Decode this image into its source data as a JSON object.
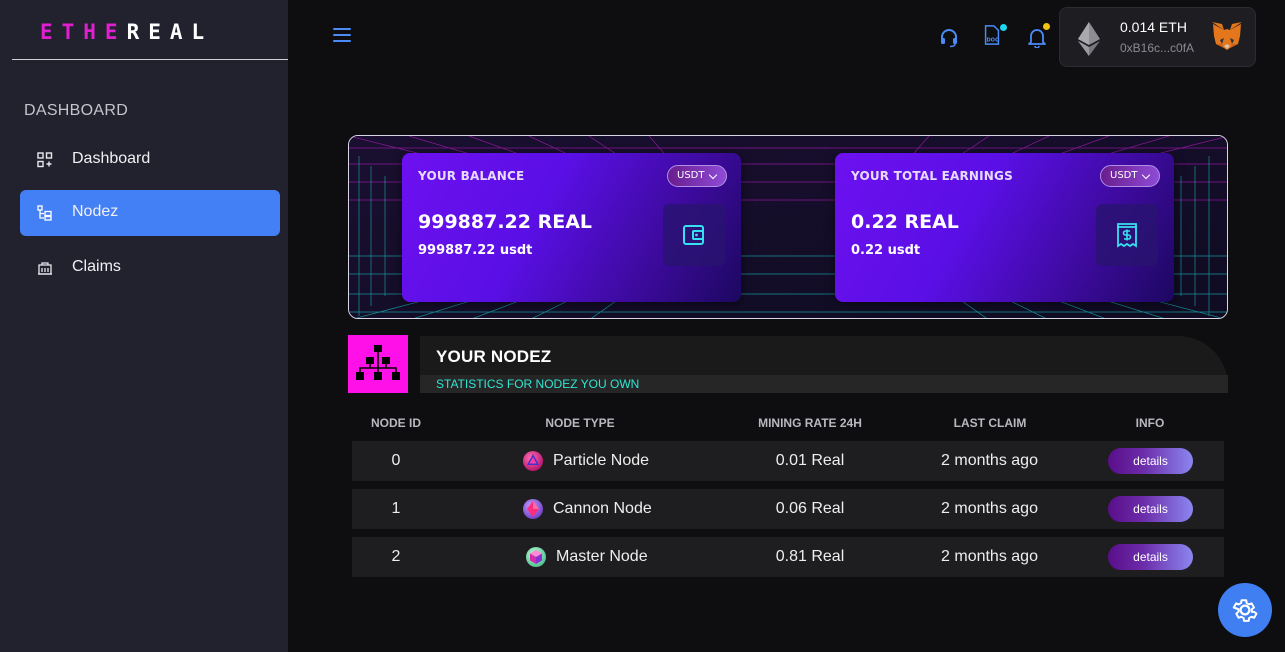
{
  "app": {
    "logo": {
      "part_a": "ETHE",
      "part_b": "REAL"
    }
  },
  "sidebar": {
    "section_label": "DASHBOARD",
    "items": [
      {
        "label": "Dashboard",
        "icon": "dashboard-icon",
        "active": false
      },
      {
        "label": "Nodez",
        "icon": "nodes-tree-icon",
        "active": true
      },
      {
        "label": "Claims",
        "icon": "claims-icon",
        "active": false
      }
    ]
  },
  "header": {
    "icons": [
      "menu-icon",
      "support-headset-icon",
      "docs-icon",
      "notification-bell-icon"
    ],
    "wallet": {
      "balance": "0.014 ETH",
      "address": "0xB16c...c0fA",
      "icon": "ethereum-icon",
      "provider_icon": "metamask-fox-icon"
    }
  },
  "banner": {
    "balance_card": {
      "title": "YOUR BALANCE",
      "currency": "USDT",
      "amount": "999887.22 REAL",
      "usdt": "999887.22 usdt",
      "icon": "wallet-icon"
    },
    "earnings_card": {
      "title": "YOUR TOTAL EARNINGS",
      "currency": "USDT",
      "amount": "0.22 REAL",
      "usdt": "0.22 usdt",
      "icon": "receipt-dollar-icon"
    }
  },
  "nodez": {
    "title": "YOUR NODEZ",
    "subtitle": "STATISTICS FOR NODEZ YOU OWN",
    "columns": [
      "NODE ID",
      "NODE TYPE",
      "MINING RATE 24H",
      "LAST CLAIM",
      "INFO"
    ],
    "rows": [
      {
        "id": "0",
        "type": "Particle Node",
        "icon": "particle-node-icon",
        "rate": "0.01 Real",
        "last_claim": "2 months ago",
        "action": "details"
      },
      {
        "id": "1",
        "type": "Cannon Node",
        "icon": "cannon-node-icon",
        "rate": "0.06 Real",
        "last_claim": "2 months ago",
        "action": "details"
      },
      {
        "id": "2",
        "type": "Master Node",
        "icon": "master-node-icon",
        "rate": "0.81 Real",
        "last_claim": "2 months ago",
        "action": "details"
      }
    ]
  },
  "colors": {
    "accent": "#4480f5",
    "logo_pink": "#e01fd1",
    "nodez_icon_bg": "#ff10e8",
    "subtitle_cyan": "#2ee6d4",
    "card_purple": "#6d10f0"
  }
}
